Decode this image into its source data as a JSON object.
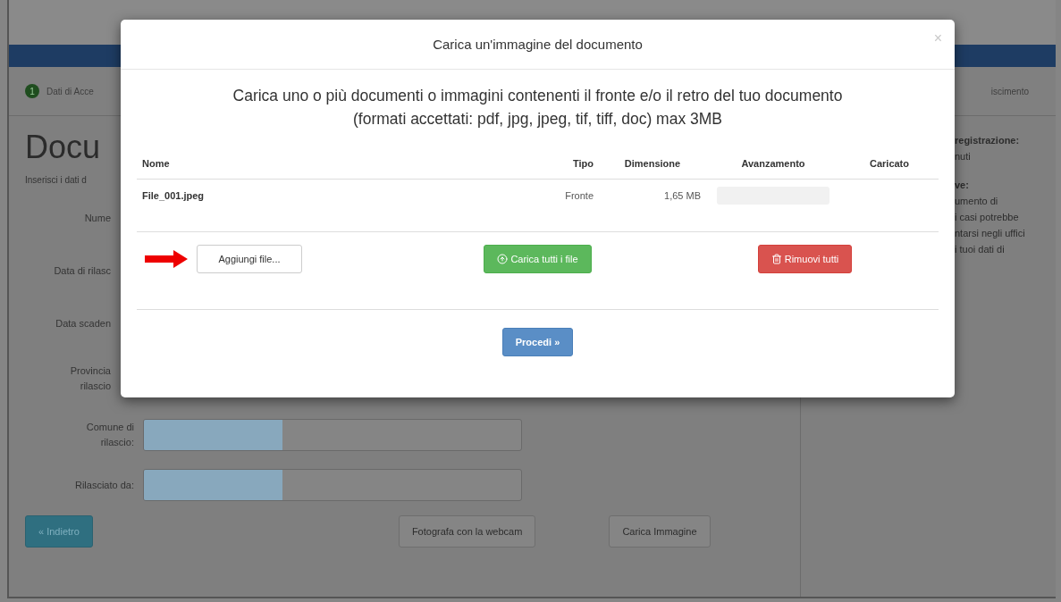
{
  "background_page": {
    "stepper": {
      "step_number": "1",
      "label": "Dati di Acce",
      "right_label": "iscimento"
    },
    "title": "Docu",
    "intro": "Inserisci i dati d",
    "rows": [
      {
        "kind": "covered",
        "label": [
          "Nume"
        ]
      },
      {
        "kind": "covered",
        "label": [
          "Data di rilasc"
        ]
      },
      {
        "kind": "covered",
        "label": [
          "Data scaden"
        ]
      },
      {
        "kind": "covered",
        "label": [
          "Provincia",
          "rilascio"
        ]
      },
      {
        "kind": "field",
        "label": [
          "Comune di",
          "rilascio:"
        ]
      },
      {
        "kind": "field",
        "label": [
          "Rilasciato da:"
        ]
      }
    ],
    "buttons": [
      {
        "kind": "primary",
        "label": "« Indietro"
      },
      {
        "kind": "default",
        "label": "Fotografa con la webcam"
      },
      {
        "kind": "default",
        "label": "Carica Immagine"
      }
    ],
    "sidebar": [
      {
        "heading": "registrazione:",
        "lines": [
          "nuti"
        ]
      },
      {
        "heading": "ve:",
        "lines": [
          "umento di",
          "i casi potrebbe",
          "ntarsi negli uffici",
          "i tuoi dati di"
        ]
      }
    ]
  },
  "modal": {
    "title": "Carica un'immagine del documento",
    "close": "×",
    "intro_lines": [
      "Carica uno o più documenti o immagini contenenti il fronte e/o il retro del tuo documento",
      "(formati accettati: pdf, jpg, jpeg, tif, tiff, doc) max 3MB"
    ],
    "table": {
      "columns": [
        "Nome",
        "Tipo",
        "Dimensione",
        "Avanzamento",
        "Caricato"
      ],
      "rows": [
        {
          "name": "File_001.jpeg",
          "type": "Fronte",
          "size": "1,65 MB",
          "level": 0
        }
      ]
    },
    "actions": [
      {
        "kind": "default",
        "label": "Aggiungi file..."
      },
      {
        "kind": "success",
        "label": "Carica tutti i file"
      },
      {
        "kind": "danger",
        "label": "Rimuovi tutti"
      }
    ],
    "proceed": "Procedi »"
  }
}
